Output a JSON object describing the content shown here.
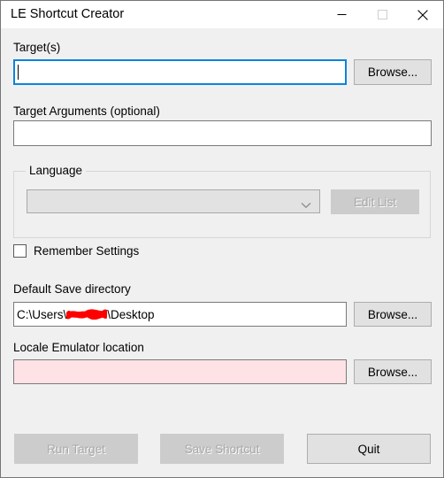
{
  "window": {
    "title": "LE Shortcut Creator",
    "caption_buttons": [
      {
        "name": "minimize",
        "glyph": "minimize-icon",
        "label": "Minimize",
        "enabled": true
      },
      {
        "name": "maximize",
        "glyph": "maximize-icon",
        "label": "Maximize",
        "enabled": false
      },
      {
        "name": "close",
        "glyph": "close-icon",
        "label": "Close",
        "enabled": true
      }
    ]
  },
  "colors": {
    "window_background": "#f0f0f0",
    "titlebar_background": "#ffffff",
    "focus_border": "#0a84dc",
    "invalid_field_background": "#ffe2e6",
    "redaction": "#ff0000",
    "disabled_button_background": "#cccccc",
    "disabled_text": "#a8a8a8",
    "button_background": "#e1e1e1"
  },
  "fields": {
    "target": {
      "label": "Target(s)",
      "value": "",
      "placeholder": "",
      "focused": true,
      "browse_label": "Browse..."
    },
    "target_arguments": {
      "label": "Target Arguments (optional)",
      "value": "",
      "placeholder": "",
      "focused": false
    },
    "language": {
      "group_label": "Language",
      "selected": "",
      "placeholder": "",
      "enabled": false,
      "edit_list_label": "Edit List",
      "edit_list_enabled": false
    },
    "remember_settings": {
      "label": "Remember Settings",
      "checked": false
    },
    "default_save_directory": {
      "label": "Default Save directory",
      "value_prefix": "C:\\Users\\",
      "value_suffix": "\\Desktop",
      "redacted": true,
      "browse_label": "Browse...",
      "focused": false
    },
    "locale_emulator_location": {
      "label": "Locale Emulator location",
      "value": "",
      "placeholder": "",
      "invalid": true,
      "browse_label": "Browse...",
      "focused": false
    }
  },
  "actions": {
    "run_target": {
      "label": "Run Target",
      "enabled": false
    },
    "save_shortcut": {
      "label": "Save Shortcut",
      "enabled": false
    },
    "quit": {
      "label": "Quit",
      "enabled": true
    }
  }
}
